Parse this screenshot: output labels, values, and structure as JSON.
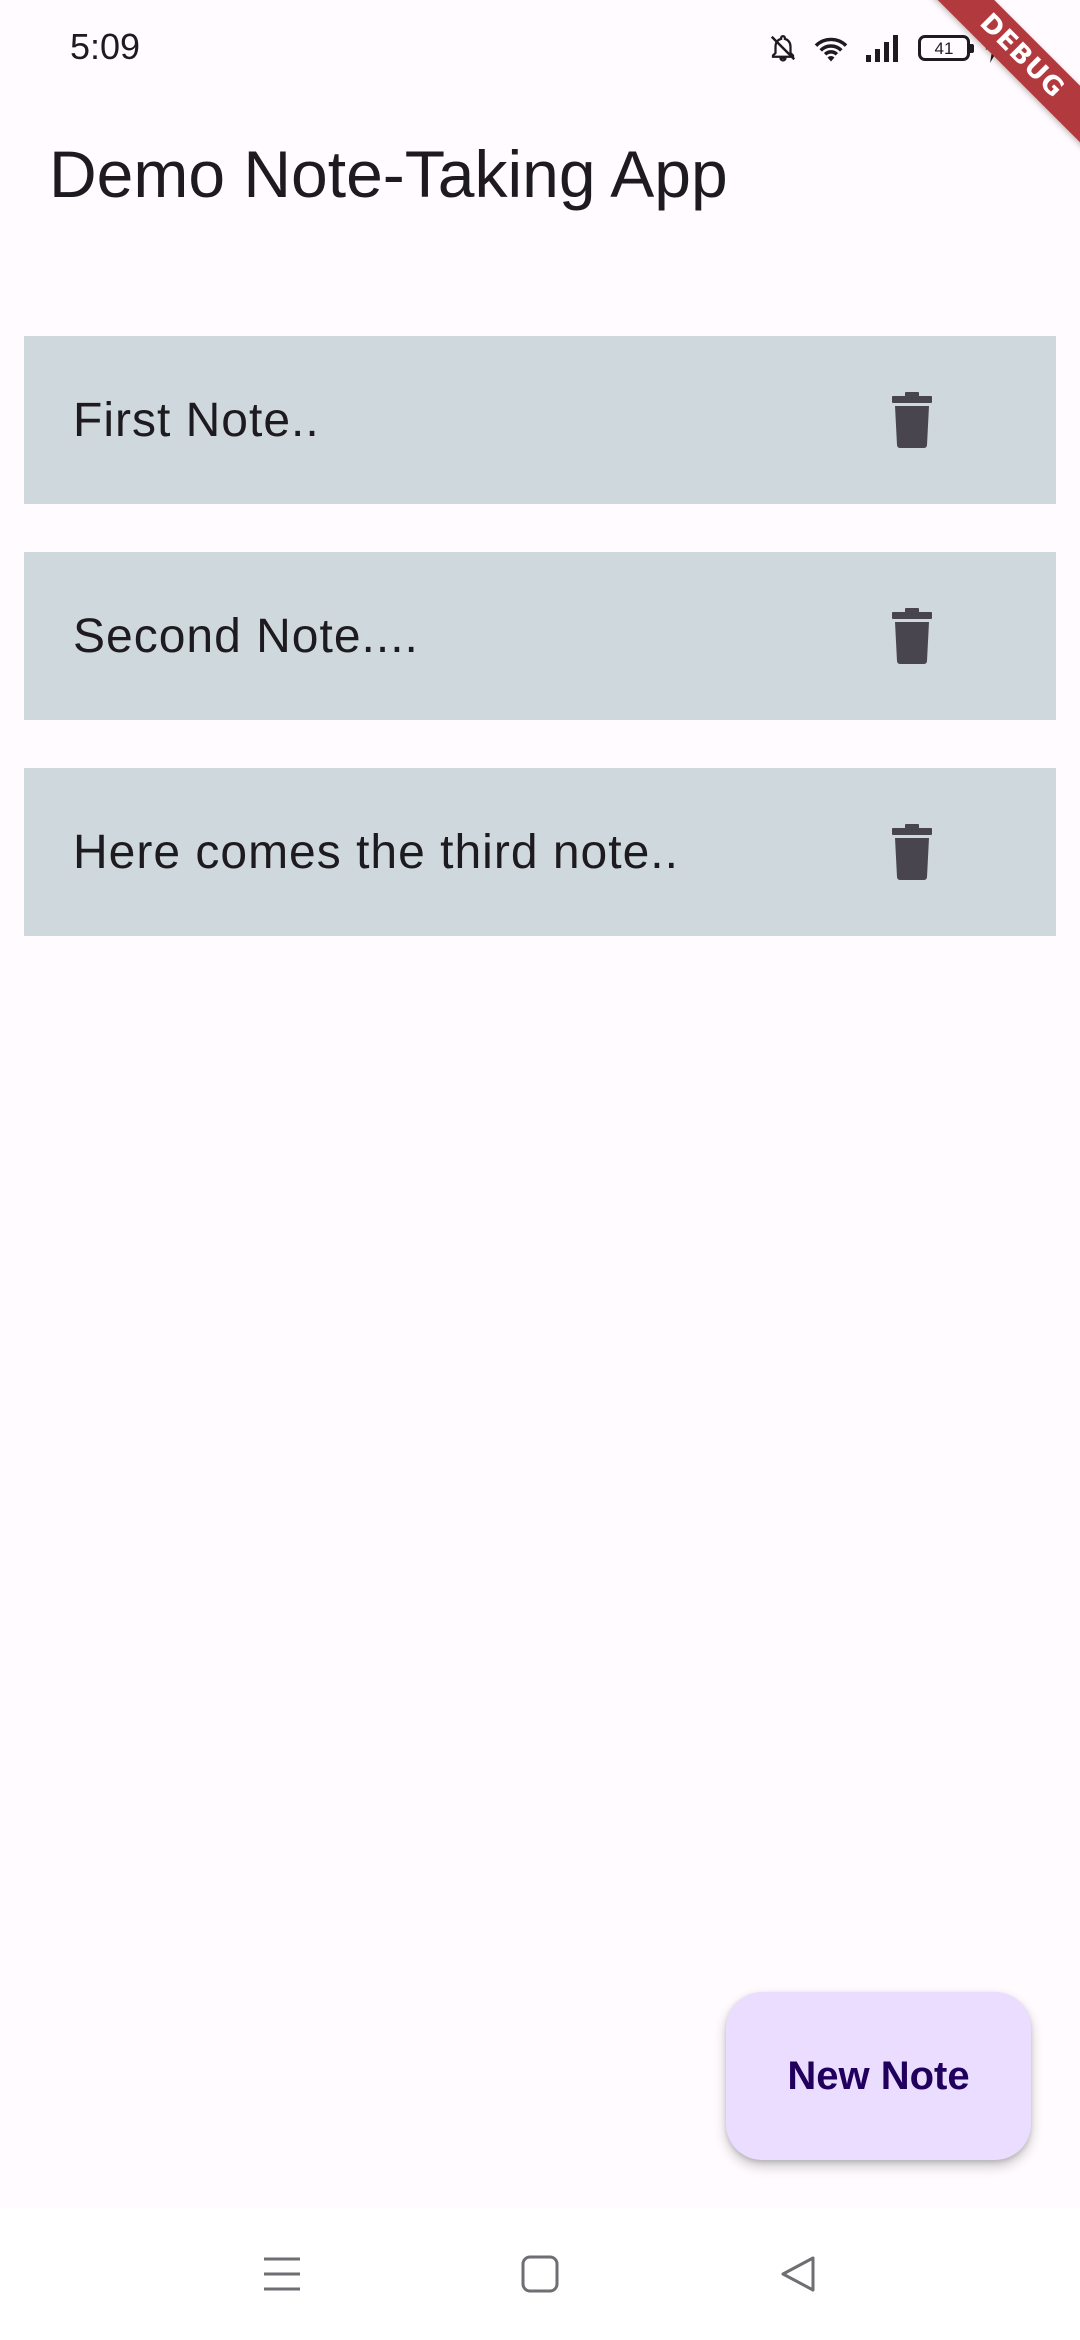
{
  "status_bar": {
    "time": "5:09",
    "battery_level": "41",
    "icons": [
      "notifications-off-icon",
      "wifi-icon",
      "signal-icon",
      "battery-icon",
      "charging-icon"
    ]
  },
  "debug_banner": {
    "label": "DEBUG"
  },
  "app_bar": {
    "title": "Demo Note-Taking App"
  },
  "notes": [
    {
      "text": "First Note..",
      "delete_icon": "trash-icon"
    },
    {
      "text": "Second Note....",
      "delete_icon": "trash-icon"
    },
    {
      "text": "Here comes the third note..",
      "delete_icon": "trash-icon"
    }
  ],
  "fab": {
    "label": "New Note"
  },
  "nav_bar": {
    "icons": [
      "menu-icon",
      "home-icon",
      "back-icon"
    ]
  },
  "colors": {
    "background": "#fffbfe",
    "note_card": "#cfd8dc",
    "delete_icon": "#49454f",
    "fab_background": "#eaddff",
    "fab_text": "#21005d",
    "debug_ribbon": "#b23a3e"
  }
}
